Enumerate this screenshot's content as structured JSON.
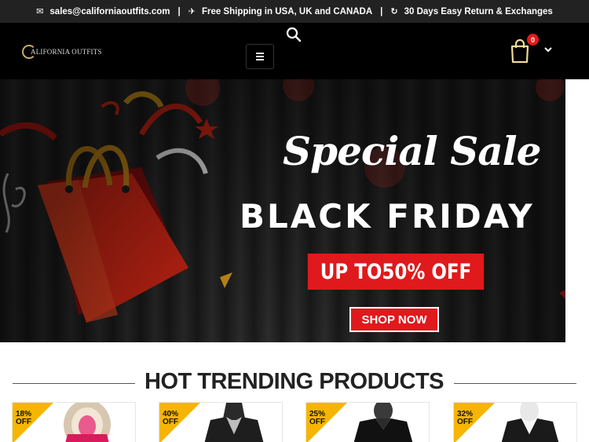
{
  "topbar": {
    "email": "sales@californiaoutfits.com",
    "shipping": "Free Shipping in USA, UK and CANADA",
    "returns": "30 Days Easy Return & Exchanges",
    "separator": "|"
  },
  "header": {
    "logo_text": "ALIFORNIA OUTFITS",
    "cart_count": "0"
  },
  "banner": {
    "headline": "Special Sale",
    "subheadline": "BLACK FRIDAY",
    "offer": "UP TO50% OFF",
    "cta": "SHOP NOW"
  },
  "section": {
    "title": "HOT TRENDING PRODUCTS"
  },
  "products": [
    {
      "discount": "18%",
      "off": "OFF"
    },
    {
      "discount": "40%",
      "off": "OFF"
    },
    {
      "discount": "25%",
      "off": "OFF"
    },
    {
      "discount": "32%",
      "off": "OFF"
    }
  ],
  "colors": {
    "accent_red": "#e0191c",
    "badge_yellow": "#f6b500",
    "header_bg": "#000000",
    "topbar_bg": "#222222"
  },
  "icons": {
    "email": "envelope-icon",
    "shipping": "plane-icon",
    "returns": "refresh-icon",
    "search": "search-icon",
    "menu": "hamburger-icon",
    "cart": "shopping-bag-icon",
    "dropdown": "chevron-down-icon"
  }
}
